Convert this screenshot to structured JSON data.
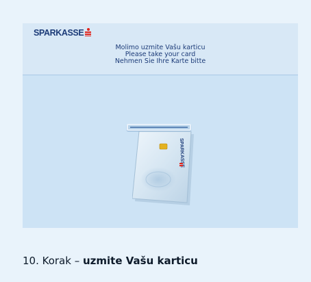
{
  "atm": {
    "logo_text": "SPARKASSE",
    "brand_colors": {
      "navy": "#1c3b78",
      "red": "#e2231a",
      "screen_bg": "#cde3f5"
    },
    "prompt_lines": [
      "Molimo uzmite Vašu karticu",
      "Please take your card",
      "Nehmen Sie Ihre Karte bitte"
    ],
    "card": {
      "brand_text": "SPARKASSE",
      "chip_color": "#e3b221"
    },
    "icons": [
      "sparkasse-logo-icon",
      "card-slot-icon",
      "bank-card-icon"
    ]
  },
  "caption": {
    "step": "10. Korak – ",
    "action": "uzmite Vašu karticu"
  }
}
